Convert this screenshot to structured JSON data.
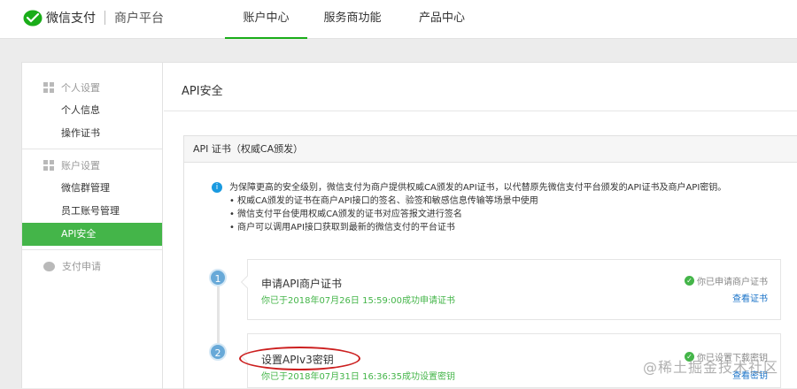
{
  "header": {
    "brand": "微信支付",
    "platform": "商户平台",
    "nav": [
      {
        "label": "账户中心",
        "active": true
      },
      {
        "label": "服务商功能",
        "active": false
      },
      {
        "label": "产品中心",
        "active": false
      }
    ]
  },
  "sidebar": {
    "groups": [
      {
        "label": "个人设置",
        "icon": "grid-icon",
        "items": [
          "个人信息",
          "操作证书"
        ]
      },
      {
        "label": "账户设置",
        "icon": "grid-icon",
        "items": [
          "微信群管理",
          "员工账号管理",
          "API安全"
        ]
      },
      {
        "label": "支付申请",
        "icon": "chat-icon",
        "items": []
      }
    ],
    "active_item": "API安全"
  },
  "main": {
    "title": "API安全",
    "panel_title": "API 证书（权威CA颁发）",
    "info": "为保障更高的安全级别，微信支付为商户提供权威CA颁发的API证书，以代替原先微信支付平台颁发的API证书及商户API密钥。",
    "bullets": [
      "• 权威CA颁发的证书在商户API接口的签名、验签和敏感信息传输等场景中使用",
      "• 微信支付平台使用权威CA颁发的证书对应答报文进行签名",
      "• 商户可以调用API接口获取到最新的微信支付的平台证书"
    ],
    "steps": [
      {
        "num": "1",
        "title": "申请API商户证书",
        "sub": "你已于2018年07月26日 15:59:00成功申请证书",
        "status": "你已申请商户证书",
        "link": "查看证书"
      },
      {
        "num": "2",
        "title": "设置APIv3密钥",
        "sub": "你已于2018年07月31日 16:36:35成功设置密钥",
        "status": "你已设置下载密钥",
        "link": "查看密钥"
      }
    ]
  },
  "watermark": "@稀土掘金技术社区",
  "colors": {
    "accent": "#44b549",
    "link": "#1a73c8",
    "annotation": "#cc1f1f"
  }
}
